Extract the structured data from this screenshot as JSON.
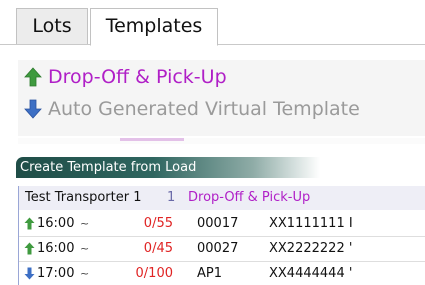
{
  "tabs": [
    {
      "label": "Lots",
      "active": false
    },
    {
      "label": "Templates",
      "active": true
    }
  ],
  "templates": [
    {
      "label": "Drop-Off & Pick-Up",
      "icon": "green-up-arrow-icon",
      "color": "#b01fc7"
    },
    {
      "label": "Auto Generated Virtual Template",
      "icon": "blue-down-arrow-icon",
      "color": "#9a9a9a"
    }
  ],
  "section": {
    "title": "Create Template from Load"
  },
  "load": {
    "header": {
      "name": "Test Transporter 1",
      "count": "1",
      "template": "Drop-Off & Pick-Up"
    },
    "rows": [
      {
        "icon": "green-up-arrow-icon",
        "time": "16:00",
        "tilde": "~",
        "fraction": "0/55",
        "code": "00017",
        "ref": "XX1111111 I"
      },
      {
        "icon": "green-up-arrow-icon",
        "time": "16:00",
        "tilde": "~",
        "fraction": "0/45",
        "code": "00027",
        "ref": "XX2222222 '"
      },
      {
        "icon": "blue-down-arrow-icon",
        "time": "17:00",
        "tilde": "~",
        "fraction": "0/100",
        "code": "AP1",
        "ref": "XX4444444 '"
      }
    ]
  },
  "colors": {
    "accent_purple": "#b01fc7",
    "danger_red": "#e02424",
    "header_teal": "#1f4d47",
    "arrow_green": "#3f9a3f",
    "arrow_blue": "#3d6fc4"
  }
}
